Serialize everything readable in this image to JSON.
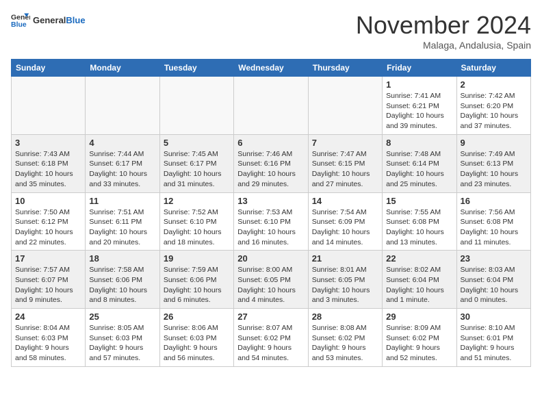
{
  "header": {
    "logo_general": "General",
    "logo_blue": "Blue",
    "month_title": "November 2024",
    "location": "Malaga, Andalusia, Spain"
  },
  "weekdays": [
    "Sunday",
    "Monday",
    "Tuesday",
    "Wednesday",
    "Thursday",
    "Friday",
    "Saturday"
  ],
  "weeks": [
    [
      {
        "day": "",
        "info": ""
      },
      {
        "day": "",
        "info": ""
      },
      {
        "day": "",
        "info": ""
      },
      {
        "day": "",
        "info": ""
      },
      {
        "day": "",
        "info": ""
      },
      {
        "day": "1",
        "info": "Sunrise: 7:41 AM\nSunset: 6:21 PM\nDaylight: 10 hours and 39 minutes."
      },
      {
        "day": "2",
        "info": "Sunrise: 7:42 AM\nSunset: 6:20 PM\nDaylight: 10 hours and 37 minutes."
      }
    ],
    [
      {
        "day": "3",
        "info": "Sunrise: 7:43 AM\nSunset: 6:18 PM\nDaylight: 10 hours and 35 minutes."
      },
      {
        "day": "4",
        "info": "Sunrise: 7:44 AM\nSunset: 6:17 PM\nDaylight: 10 hours and 33 minutes."
      },
      {
        "day": "5",
        "info": "Sunrise: 7:45 AM\nSunset: 6:17 PM\nDaylight: 10 hours and 31 minutes."
      },
      {
        "day": "6",
        "info": "Sunrise: 7:46 AM\nSunset: 6:16 PM\nDaylight: 10 hours and 29 minutes."
      },
      {
        "day": "7",
        "info": "Sunrise: 7:47 AM\nSunset: 6:15 PM\nDaylight: 10 hours and 27 minutes."
      },
      {
        "day": "8",
        "info": "Sunrise: 7:48 AM\nSunset: 6:14 PM\nDaylight: 10 hours and 25 minutes."
      },
      {
        "day": "9",
        "info": "Sunrise: 7:49 AM\nSunset: 6:13 PM\nDaylight: 10 hours and 23 minutes."
      }
    ],
    [
      {
        "day": "10",
        "info": "Sunrise: 7:50 AM\nSunset: 6:12 PM\nDaylight: 10 hours and 22 minutes."
      },
      {
        "day": "11",
        "info": "Sunrise: 7:51 AM\nSunset: 6:11 PM\nDaylight: 10 hours and 20 minutes."
      },
      {
        "day": "12",
        "info": "Sunrise: 7:52 AM\nSunset: 6:10 PM\nDaylight: 10 hours and 18 minutes."
      },
      {
        "day": "13",
        "info": "Sunrise: 7:53 AM\nSunset: 6:10 PM\nDaylight: 10 hours and 16 minutes."
      },
      {
        "day": "14",
        "info": "Sunrise: 7:54 AM\nSunset: 6:09 PM\nDaylight: 10 hours and 14 minutes."
      },
      {
        "day": "15",
        "info": "Sunrise: 7:55 AM\nSunset: 6:08 PM\nDaylight: 10 hours and 13 minutes."
      },
      {
        "day": "16",
        "info": "Sunrise: 7:56 AM\nSunset: 6:08 PM\nDaylight: 10 hours and 11 minutes."
      }
    ],
    [
      {
        "day": "17",
        "info": "Sunrise: 7:57 AM\nSunset: 6:07 PM\nDaylight: 10 hours and 9 minutes."
      },
      {
        "day": "18",
        "info": "Sunrise: 7:58 AM\nSunset: 6:06 PM\nDaylight: 10 hours and 8 minutes."
      },
      {
        "day": "19",
        "info": "Sunrise: 7:59 AM\nSunset: 6:06 PM\nDaylight: 10 hours and 6 minutes."
      },
      {
        "day": "20",
        "info": "Sunrise: 8:00 AM\nSunset: 6:05 PM\nDaylight: 10 hours and 4 minutes."
      },
      {
        "day": "21",
        "info": "Sunrise: 8:01 AM\nSunset: 6:05 PM\nDaylight: 10 hours and 3 minutes."
      },
      {
        "day": "22",
        "info": "Sunrise: 8:02 AM\nSunset: 6:04 PM\nDaylight: 10 hours and 1 minute."
      },
      {
        "day": "23",
        "info": "Sunrise: 8:03 AM\nSunset: 6:04 PM\nDaylight: 10 hours and 0 minutes."
      }
    ],
    [
      {
        "day": "24",
        "info": "Sunrise: 8:04 AM\nSunset: 6:03 PM\nDaylight: 9 hours and 58 minutes."
      },
      {
        "day": "25",
        "info": "Sunrise: 8:05 AM\nSunset: 6:03 PM\nDaylight: 9 hours and 57 minutes."
      },
      {
        "day": "26",
        "info": "Sunrise: 8:06 AM\nSunset: 6:03 PM\nDaylight: 9 hours and 56 minutes."
      },
      {
        "day": "27",
        "info": "Sunrise: 8:07 AM\nSunset: 6:02 PM\nDaylight: 9 hours and 54 minutes."
      },
      {
        "day": "28",
        "info": "Sunrise: 8:08 AM\nSunset: 6:02 PM\nDaylight: 9 hours and 53 minutes."
      },
      {
        "day": "29",
        "info": "Sunrise: 8:09 AM\nSunset: 6:02 PM\nDaylight: 9 hours and 52 minutes."
      },
      {
        "day": "30",
        "info": "Sunrise: 8:10 AM\nSunset: 6:01 PM\nDaylight: 9 hours and 51 minutes."
      }
    ]
  ]
}
